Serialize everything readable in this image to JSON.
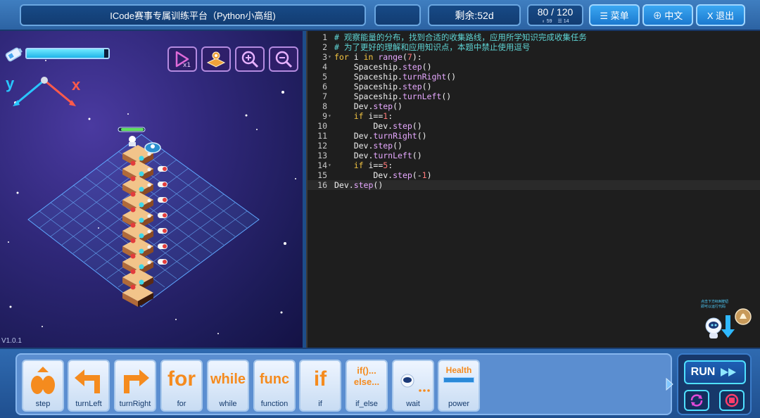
{
  "topbar": {
    "title": "ICode赛事专属训练平台（Python小高组)",
    "remaining": "剩余:52d",
    "score": "80 / 120",
    "stat_a": "59",
    "stat_b": "14",
    "menu_label": "☰ 菜单",
    "lang_label": "⊕ 中文",
    "exit_label": "X 退出"
  },
  "scene": {
    "energy_level": 0.95,
    "axis_y": "y",
    "axis_x": "x",
    "tools": [
      "speed-x1-icon",
      "map-icon",
      "zoom-in-icon",
      "zoom-out-icon"
    ],
    "version": "V1.0.1"
  },
  "editor": {
    "lines": [
      {
        "n": "1",
        "text": "# 观察能量的分布，找到合适的收集路线，应用所学知识完成收集任务"
      },
      {
        "n": "2",
        "text": "# 为了更好的理解和应用知识点，本题中禁止使用逗号"
      },
      {
        "n": "3",
        "text": "for i in range(7):"
      },
      {
        "n": "4",
        "text": "    Spaceship.step()"
      },
      {
        "n": "5",
        "text": "    Spaceship.turnRight()"
      },
      {
        "n": "6",
        "text": "    Spaceship.step()"
      },
      {
        "n": "7",
        "text": "    Spaceship.turnLeft()"
      },
      {
        "n": "8",
        "text": "    Dev.step()"
      },
      {
        "n": "9",
        "text": "    if i==1:"
      },
      {
        "n": "10",
        "text": "        Dev.step()"
      },
      {
        "n": "11",
        "text": "    Dev.turnRight()"
      },
      {
        "n": "12",
        "text": "    Dev.step()"
      },
      {
        "n": "13",
        "text": "    Dev.turnLeft()"
      },
      {
        "n": "14",
        "text": "    if i==5:"
      },
      {
        "n": "15",
        "text": "        Dev.step(-1)"
      },
      {
        "n": "16",
        "text": "Dev.step()"
      }
    ],
    "helper_text": "点击下方RUN按钮\n即可以运行代码"
  },
  "blocks": [
    {
      "label": "step",
      "glyph": "step-icon"
    },
    {
      "label": "turnLeft",
      "glyph": "turn-left-icon"
    },
    {
      "label": "turnRight",
      "glyph": "turn-right-icon"
    },
    {
      "label": "for",
      "glyph": "for"
    },
    {
      "label": "while",
      "glyph": "while"
    },
    {
      "label": "function",
      "glyph": "func"
    },
    {
      "label": "if",
      "glyph": "if"
    },
    {
      "label": "if_else",
      "glyph": "if()...\nelse..."
    },
    {
      "label": "wait",
      "glyph": "wait-icon"
    },
    {
      "label": "power",
      "glyph": "Health"
    }
  ],
  "run": {
    "label": "RUN"
  },
  "colors": {
    "comment": "#5fd4d4",
    "keyword": "#f4c542",
    "function": "#e6a8ff",
    "number": "#ff7b7b",
    "block_glyph": "#f58b1e"
  }
}
